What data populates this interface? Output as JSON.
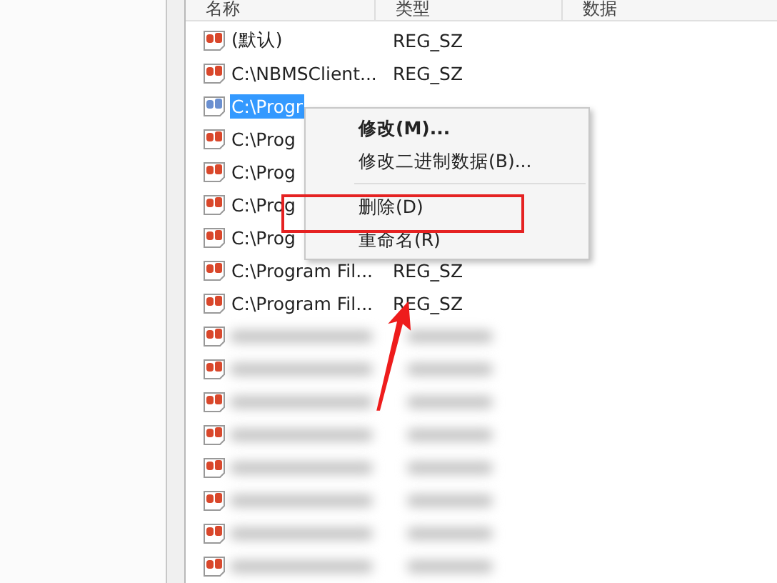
{
  "columns": [
    {
      "label": "名称"
    },
    {
      "label": "类型"
    },
    {
      "label": "数据"
    }
  ],
  "rows": [
    {
      "kind": "value",
      "name": "(默认)",
      "type": "REG_SZ",
      "selected": false
    },
    {
      "kind": "value",
      "name": "C:\\NBMSClient...",
      "type": "REG_SZ",
      "selected": false
    },
    {
      "kind": "value",
      "name": "C:\\Progr",
      "selected": true
    },
    {
      "kind": "value",
      "name": "C:\\Prog",
      "selected": false
    },
    {
      "kind": "value",
      "name": "C:\\Prog",
      "selected": false
    },
    {
      "kind": "value",
      "name": "C:\\Prog",
      "selected": false
    },
    {
      "kind": "value",
      "name": "C:\\Prog",
      "selected": false
    },
    {
      "kind": "value",
      "name": "C:\\Program Fil...",
      "type": "REG_SZ",
      "selected": false
    },
    {
      "kind": "value",
      "name": "C:\\Program Fil...",
      "type": "REG_SZ",
      "selected": false
    },
    {
      "kind": "blurred"
    },
    {
      "kind": "blurred"
    },
    {
      "kind": "blurred"
    },
    {
      "kind": "blurred"
    },
    {
      "kind": "blurred"
    },
    {
      "kind": "blurred"
    },
    {
      "kind": "blurred"
    },
    {
      "kind": "blurred"
    }
  ],
  "context_menu": {
    "items": [
      {
        "kind": "item",
        "label": "修改(M)...",
        "default": true
      },
      {
        "kind": "item",
        "label": "修改二进制数据(B)...",
        "default": false
      },
      {
        "kind": "separator"
      },
      {
        "kind": "item",
        "label": "删除(D)",
        "default": false
      },
      {
        "kind": "item",
        "label": "重命名(R)",
        "default": false
      }
    ]
  },
  "annotations": {
    "highlight_box": true,
    "arrow": true
  }
}
